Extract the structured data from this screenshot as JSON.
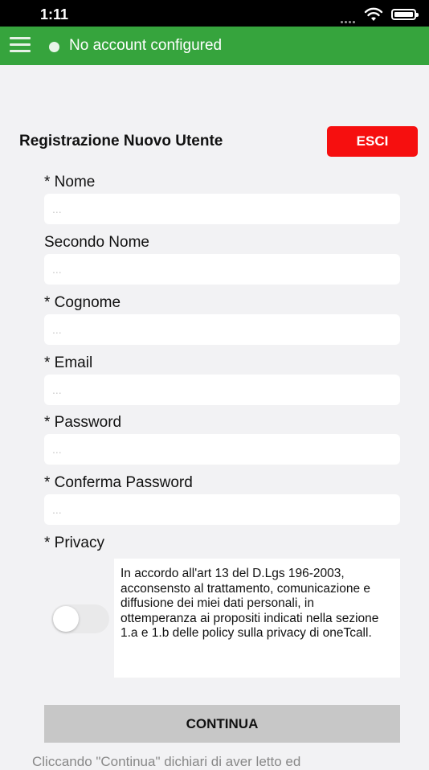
{
  "status_bar": {
    "time": "1:11"
  },
  "header": {
    "account_status": "No account configured"
  },
  "form": {
    "title": "Registrazione Nuovo Utente",
    "exit_button": "ESCI",
    "fields": [
      {
        "label": "* Nome",
        "placeholder": "...",
        "value": ""
      },
      {
        "label": "Secondo Nome",
        "placeholder": "...",
        "value": ""
      },
      {
        "label": "* Cognome",
        "placeholder": "...",
        "value": ""
      },
      {
        "label": "* Email",
        "placeholder": "...",
        "value": ""
      },
      {
        "label": "* Password",
        "placeholder": "...",
        "value": ""
      },
      {
        "label": "* Conferma Password",
        "placeholder": "...",
        "value": ""
      }
    ],
    "privacy": {
      "label": "* Privacy",
      "text": "In accordo all'art 13 del D.Lgs 196-2003, acconsensto al trattamento,  comunicazione e diffusione dei miei dati personali, in ottemperanza ai propositi indicati nella sezione 1.a e 1.b delle policy sulla privacy di oneTcall.",
      "accepted": false
    },
    "continue_button": "CONTINUA",
    "footer_text": "Cliccando \"Continua\" dichiari di aver letto ed"
  },
  "colors": {
    "header_green": "#36a43d",
    "exit_red": "#f60f0f",
    "continue_gray": "#c7c7c7",
    "background": "#f2f2f4"
  }
}
